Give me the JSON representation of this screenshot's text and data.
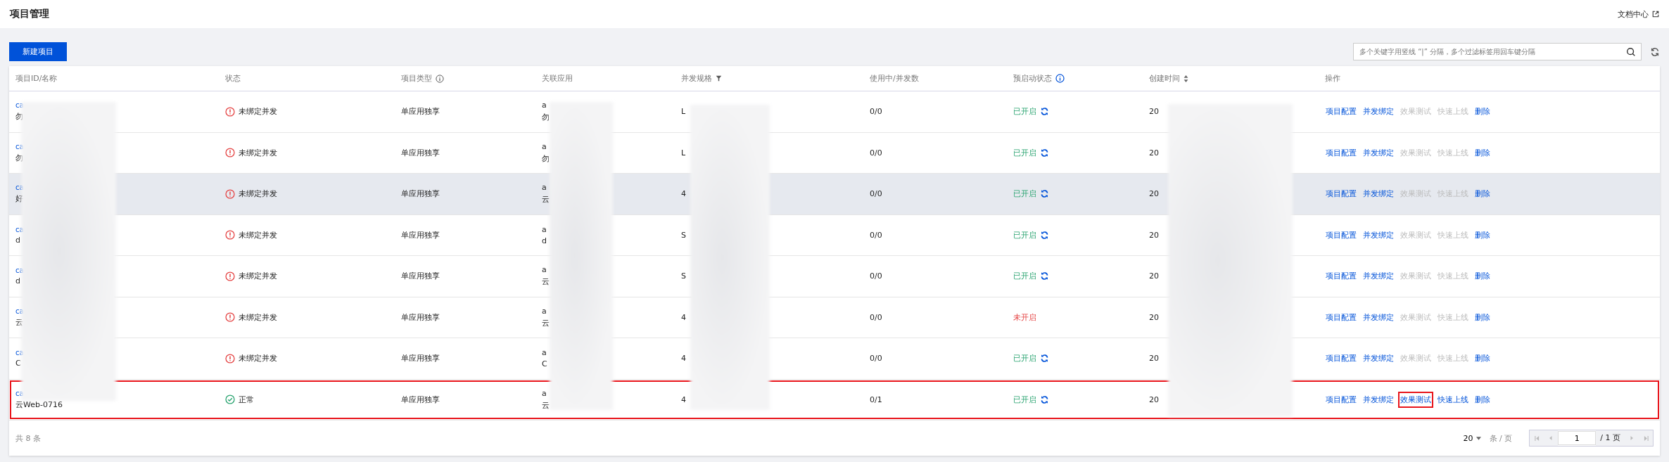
{
  "page": {
    "title": "项目管理",
    "doc_link": "文档中心"
  },
  "toolbar": {
    "create_button": "新建项目",
    "search": {
      "placeholder": "多个关键字用竖线 “|” 分隔，多个过滤标签用回车键分隔"
    }
  },
  "table": {
    "columns": [
      {
        "label": "项目ID/名称",
        "kind": "plain"
      },
      {
        "label": "状态",
        "kind": "plain"
      },
      {
        "label": "项目类型",
        "kind": "info"
      },
      {
        "label": "关联应用",
        "kind": "plain"
      },
      {
        "label": "并发规格",
        "kind": "filter"
      },
      {
        "label": "使用中/并发数",
        "kind": "plain"
      },
      {
        "label": "预启动状态",
        "kind": "info-accent"
      },
      {
        "label": "创建时间",
        "kind": "sort"
      },
      {
        "label": "操作",
        "kind": "plain"
      }
    ],
    "rows": [
      {
        "id": "ca",
        "name": "勿",
        "status": {
          "kind": "error",
          "text": "未绑定并发"
        },
        "type": "单应用独享",
        "app": [
          "a",
          "勿"
        ],
        "spec": "L",
        "usage": "0/0",
        "prestart": {
          "on": true,
          "text": "已开启"
        },
        "created": "20",
        "hovered": false,
        "highlighted": false,
        "actions": [
          {
            "label": "项目配置",
            "disabled": false,
            "boxed": false
          },
          {
            "label": "并发绑定",
            "disabled": false,
            "boxed": false
          },
          {
            "label": "效果测试",
            "disabled": true,
            "boxed": false
          },
          {
            "label": "快速上线",
            "disabled": true,
            "boxed": false
          },
          {
            "label": "删除",
            "disabled": false,
            "boxed": false
          }
        ]
      },
      {
        "id": "ca",
        "name": "勿",
        "status": {
          "kind": "error",
          "text": "未绑定并发"
        },
        "type": "单应用独享",
        "app": [
          "a",
          "勿"
        ],
        "spec": "L",
        "usage": "0/0",
        "prestart": {
          "on": true,
          "text": "已开启"
        },
        "created": "20",
        "hovered": false,
        "highlighted": false,
        "actions": [
          {
            "label": "项目配置",
            "disabled": false,
            "boxed": false
          },
          {
            "label": "并发绑定",
            "disabled": false,
            "boxed": false
          },
          {
            "label": "效果测试",
            "disabled": true,
            "boxed": false
          },
          {
            "label": "快速上线",
            "disabled": true,
            "boxed": false
          },
          {
            "label": "删除",
            "disabled": false,
            "boxed": false
          }
        ]
      },
      {
        "id": "ca",
        "name": "好",
        "status": {
          "kind": "error",
          "text": "未绑定并发"
        },
        "type": "单应用独享",
        "app": [
          "a",
          "云"
        ],
        "spec": "4",
        "usage": "0/0",
        "prestart": {
          "on": true,
          "text": "已开启"
        },
        "created": "20",
        "hovered": true,
        "highlighted": false,
        "actions": [
          {
            "label": "项目配置",
            "disabled": false,
            "boxed": false
          },
          {
            "label": "并发绑定",
            "disabled": false,
            "boxed": false
          },
          {
            "label": "效果测试",
            "disabled": true,
            "boxed": false
          },
          {
            "label": "快速上线",
            "disabled": true,
            "boxed": false
          },
          {
            "label": "删除",
            "disabled": false,
            "boxed": false
          }
        ]
      },
      {
        "id": "ca",
        "name": "d",
        "status": {
          "kind": "error",
          "text": "未绑定并发"
        },
        "type": "单应用独享",
        "app": [
          "a",
          "d"
        ],
        "spec": "S",
        "usage": "0/0",
        "prestart": {
          "on": true,
          "text": "已开启"
        },
        "created": "20",
        "hovered": false,
        "highlighted": false,
        "actions": [
          {
            "label": "项目配置",
            "disabled": false,
            "boxed": false
          },
          {
            "label": "并发绑定",
            "disabled": false,
            "boxed": false
          },
          {
            "label": "效果测试",
            "disabled": true,
            "boxed": false
          },
          {
            "label": "快速上线",
            "disabled": true,
            "boxed": false
          },
          {
            "label": "删除",
            "disabled": false,
            "boxed": false
          }
        ]
      },
      {
        "id": "ca",
        "name": "d",
        "status": {
          "kind": "error",
          "text": "未绑定并发"
        },
        "type": "单应用独享",
        "app": [
          "a",
          "云"
        ],
        "spec": "S",
        "usage": "0/0",
        "prestart": {
          "on": true,
          "text": "已开启"
        },
        "created": "20",
        "hovered": false,
        "highlighted": false,
        "actions": [
          {
            "label": "项目配置",
            "disabled": false,
            "boxed": false
          },
          {
            "label": "并发绑定",
            "disabled": false,
            "boxed": false
          },
          {
            "label": "效果测试",
            "disabled": true,
            "boxed": false
          },
          {
            "label": "快速上线",
            "disabled": true,
            "boxed": false
          },
          {
            "label": "删除",
            "disabled": false,
            "boxed": false
          }
        ]
      },
      {
        "id": "ca",
        "name": "云",
        "status": {
          "kind": "error",
          "text": "未绑定并发"
        },
        "type": "单应用独享",
        "app": [
          "a",
          "云"
        ],
        "spec": "4",
        "usage": "0/0",
        "prestart": {
          "on": false,
          "text": "未开启"
        },
        "created": "20",
        "hovered": false,
        "highlighted": false,
        "actions": [
          {
            "label": "项目配置",
            "disabled": false,
            "boxed": false
          },
          {
            "label": "并发绑定",
            "disabled": false,
            "boxed": false
          },
          {
            "label": "效果测试",
            "disabled": true,
            "boxed": false
          },
          {
            "label": "快速上线",
            "disabled": true,
            "boxed": false
          },
          {
            "label": "删除",
            "disabled": false,
            "boxed": false
          }
        ]
      },
      {
        "id": "ca",
        "name": "C",
        "status": {
          "kind": "error",
          "text": "未绑定并发"
        },
        "type": "单应用独享",
        "app": [
          "a",
          "C"
        ],
        "spec": "4",
        "usage": "0/0",
        "prestart": {
          "on": true,
          "text": "已开启"
        },
        "created": "20",
        "hovered": false,
        "highlighted": false,
        "actions": [
          {
            "label": "项目配置",
            "disabled": false,
            "boxed": false
          },
          {
            "label": "并发绑定",
            "disabled": false,
            "boxed": false
          },
          {
            "label": "效果测试",
            "disabled": true,
            "boxed": false
          },
          {
            "label": "快速上线",
            "disabled": true,
            "boxed": false
          },
          {
            "label": "删除",
            "disabled": false,
            "boxed": false
          }
        ]
      },
      {
        "id": "ca",
        "name": "云Web-0716",
        "status": {
          "kind": "ok",
          "text": "正常"
        },
        "type": "单应用独享",
        "app": [
          "a",
          "云"
        ],
        "spec": "4",
        "usage": "0/1",
        "prestart": {
          "on": true,
          "text": "已开启"
        },
        "created": "20",
        "hovered": false,
        "highlighted": true,
        "actions": [
          {
            "label": "项目配置",
            "disabled": false,
            "boxed": false
          },
          {
            "label": "并发绑定",
            "disabled": false,
            "boxed": false
          },
          {
            "label": "效果测试",
            "disabled": false,
            "boxed": true
          },
          {
            "label": "快速上线",
            "disabled": false,
            "boxed": false
          },
          {
            "label": "删除",
            "disabled": false,
            "boxed": false
          }
        ]
      }
    ]
  },
  "footer": {
    "total": "共 8 条",
    "page_size": "20",
    "page_size_unit": "条 / 页",
    "page": "1",
    "page_total": "/ 1 页"
  }
}
